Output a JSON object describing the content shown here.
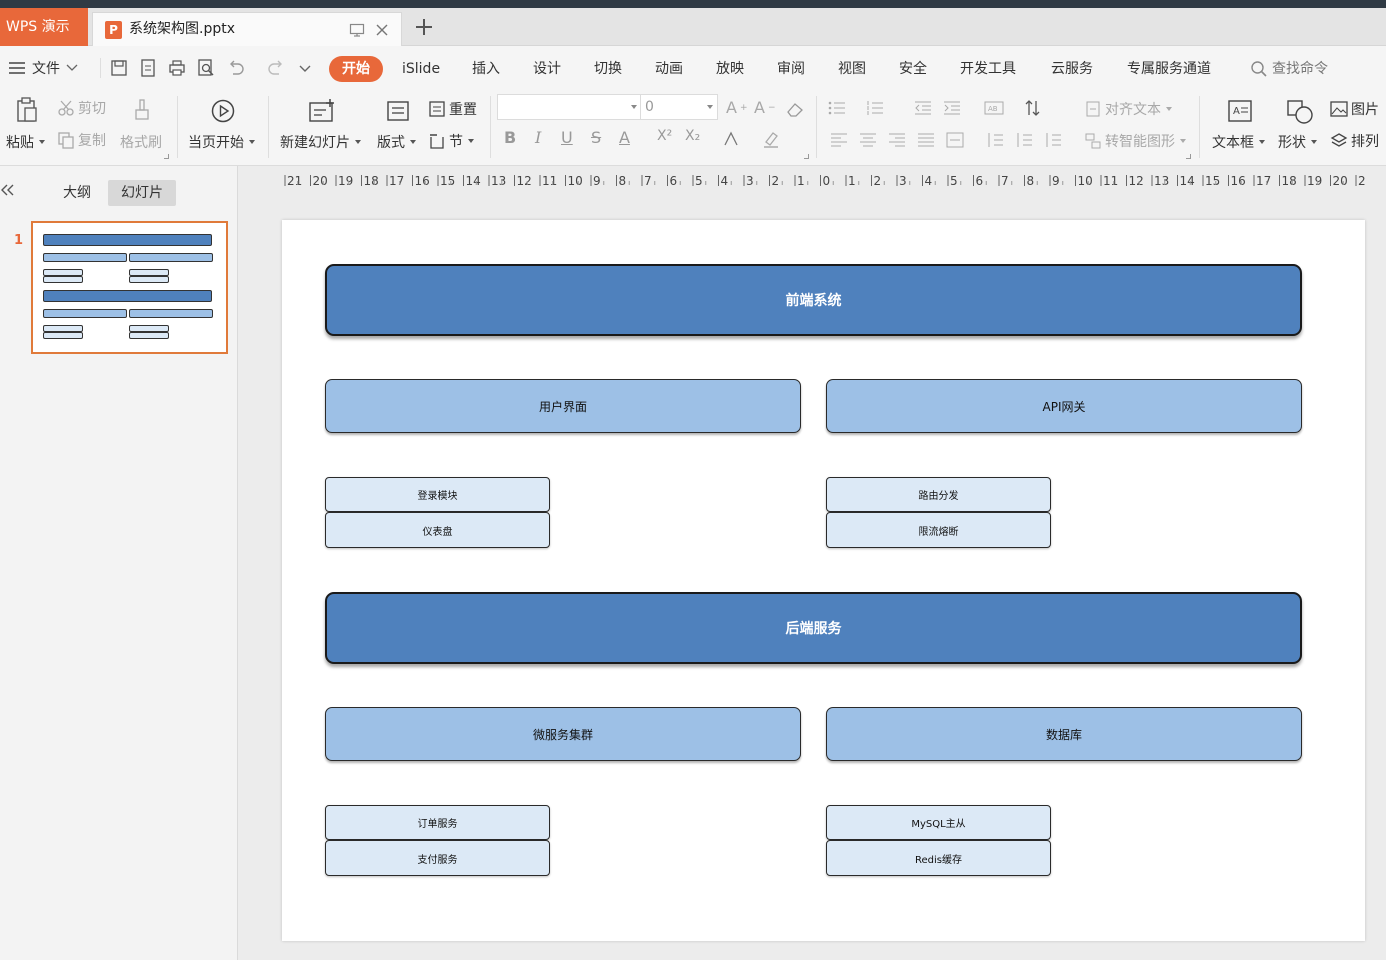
{
  "app": {
    "name": "WPS 演示",
    "document_title": "系统架构图.pptx"
  },
  "menu": {
    "file_label": "文件",
    "tabs": [
      "开始",
      "iSlide",
      "插入",
      "设计",
      "切换",
      "动画",
      "放映",
      "审阅",
      "视图",
      "安全",
      "开发工具",
      "云服务",
      "专属服务通道"
    ],
    "active_tab": "开始",
    "search_label": "查找命令"
  },
  "ribbon": {
    "paste": "粘贴",
    "cut": "剪切",
    "copy": "复制",
    "format_painter": "格式刷",
    "play_from_current": "当页开始",
    "new_slide": "新建幻灯片",
    "layout": "版式",
    "reset": "重置",
    "section": "节",
    "font_size": "0",
    "align_text": "对齐文本",
    "convert_smartart": "转智能图形",
    "text_box": "文本框",
    "shape": "形状",
    "picture": "图片",
    "arrange": "排列"
  },
  "left_pane": {
    "tabs": [
      "大纲",
      "幻灯片"
    ],
    "active_tab": "幻灯片",
    "slide_number": "1"
  },
  "ruler": {
    "labels": [
      "21",
      "20",
      "19",
      "18",
      "17",
      "16",
      "15",
      "14",
      "13",
      "12",
      "11",
      "10",
      "9",
      "8",
      "7",
      "6",
      "5",
      "4",
      "3",
      "2",
      "1",
      "0",
      "1",
      "2",
      "3",
      "4",
      "5",
      "6",
      "7",
      "8",
      "9",
      "10",
      "11",
      "12",
      "13",
      "14",
      "15",
      "16",
      "17",
      "18",
      "19",
      "20",
      "21"
    ]
  },
  "slide": {
    "frontend": {
      "title": "前端系统",
      "ui": {
        "title": "用户界面",
        "modules": [
          "登录模块",
          "仪表盘"
        ]
      },
      "gateway": {
        "title": "API网关",
        "modules": [
          "路由分发",
          "限流熔断"
        ]
      }
    },
    "backend": {
      "title": "后端服务",
      "microservices": {
        "title": "微服务集群",
        "modules": [
          "订单服务",
          "支付服务"
        ]
      },
      "database": {
        "title": "数据库",
        "modules": [
          "MySQL主从",
          "Redis缓存"
        ]
      }
    }
  },
  "colors": {
    "accent": "#e8683a",
    "level1_fill": "#4f81bd",
    "level2_fill": "#9dc0e6",
    "level3_fill": "#dce9f6"
  }
}
